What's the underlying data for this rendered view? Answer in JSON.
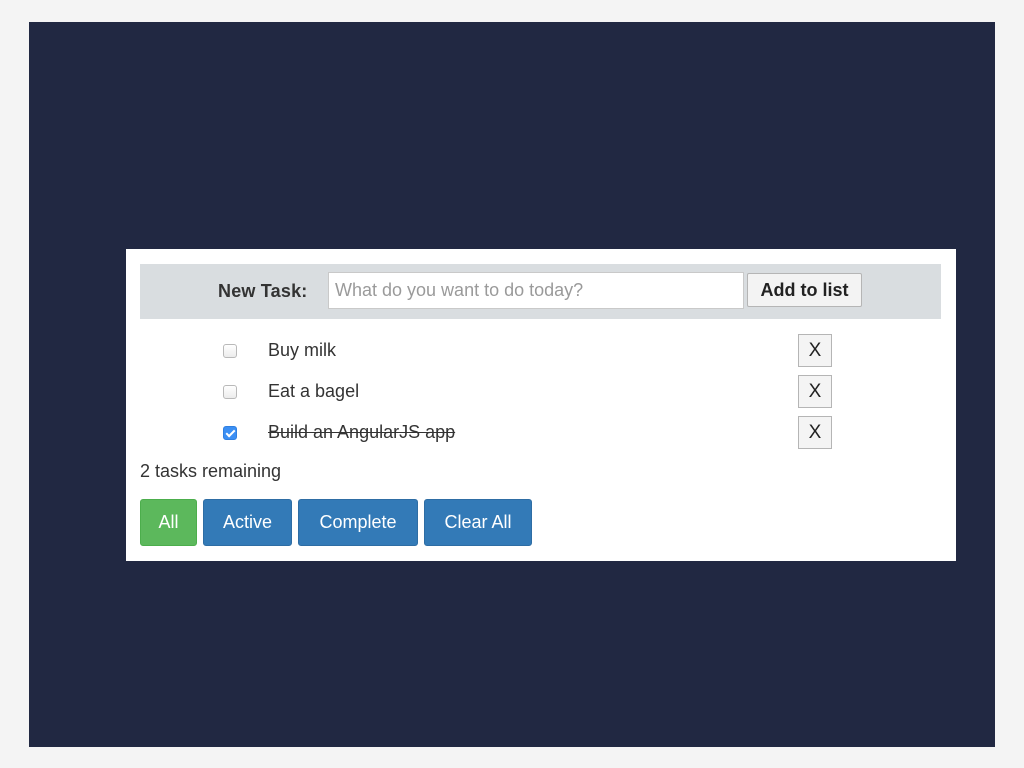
{
  "new_task": {
    "label": "New Task:",
    "placeholder": "What do you want to do today?",
    "value": "",
    "add_button": "Add to list"
  },
  "tasks": [
    {
      "text": "Buy milk",
      "done": false,
      "delete_label": "X"
    },
    {
      "text": "Eat a bagel",
      "done": false,
      "delete_label": "X"
    },
    {
      "text": "Build an AngularJS app",
      "done": true,
      "delete_label": "X"
    }
  ],
  "remaining_text": "2 tasks remaining",
  "filters": {
    "all": "All",
    "active": "Active",
    "complete": "Complete",
    "clear_all": "Clear All"
  },
  "colors": {
    "background": "#212842",
    "filter_selected": "#5cb85c",
    "filter_default": "#337ab7",
    "checkbox_checked": "#3b8ff4"
  }
}
